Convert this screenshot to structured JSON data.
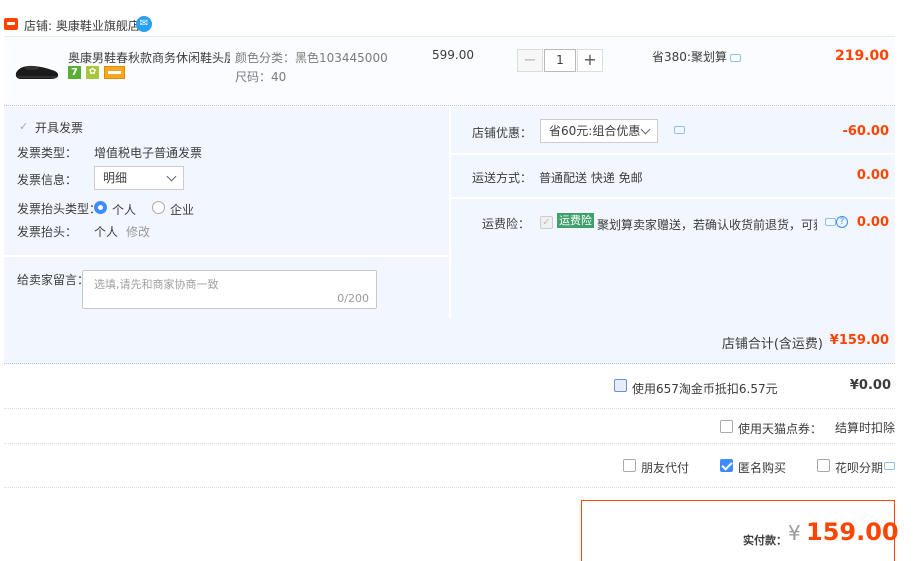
{
  "shop": {
    "name": "店铺: 奥康鞋业旗舰店"
  },
  "item": {
    "title": "奥康男鞋春秋款商务休闲鞋头层...",
    "badge_7": "7",
    "sku_color": "颜色分类：黑色103445000",
    "sku_size": "尺码：40",
    "price": "599.00",
    "quantity": "1",
    "minus": "−",
    "plus": "+",
    "discount": "省380:聚划算",
    "subtotal": "219.00"
  },
  "invoice": {
    "enable_label": "开具发票",
    "type_label": "发票类型：",
    "type_value": "增值税电子普通发票",
    "info_label": "发票信息：",
    "info_value": "明细",
    "header_type_label": "发票抬头类型：",
    "header_type_options": [
      "个人",
      "企业"
    ],
    "header_label": "发票抬头：",
    "header_value": "个人",
    "modify_link": "修改"
  },
  "message": {
    "label": "给卖家留言：",
    "placeholder": "选填,请先和商家协商一致",
    "count": "0/200"
  },
  "shop_discount": {
    "label": "店铺优惠：",
    "selected": "省60元:组合优惠",
    "value": "-60.00"
  },
  "shipping": {
    "label": "运送方式：",
    "value": "普通配送 快递 免邮",
    "price": "0.00"
  },
  "insurance": {
    "label": "运费险：",
    "tag": "运费险",
    "text": "聚划算卖家赠送，若确认收货前退货，可获...",
    "price": "0.00"
  },
  "shop_total": {
    "label": "店铺合计(含运费)",
    "value": "¥159.00"
  },
  "coins": {
    "label": "使用657淘金币抵扣6.57元",
    "value": "¥0.00"
  },
  "tmall_points": {
    "label": "使用天猫点券：",
    "value": "结算时扣除"
  },
  "options": {
    "friend_pay": "朋友代付",
    "anonymous": "匿名购买",
    "huabei": "花呗分期"
  },
  "payment": {
    "label": "实付款：",
    "currency": "¥",
    "amount": "159.00"
  },
  "colors": {
    "accent": "#ff4400",
    "panel": "#f2f7ff",
    "check": "#3c8cff"
  }
}
